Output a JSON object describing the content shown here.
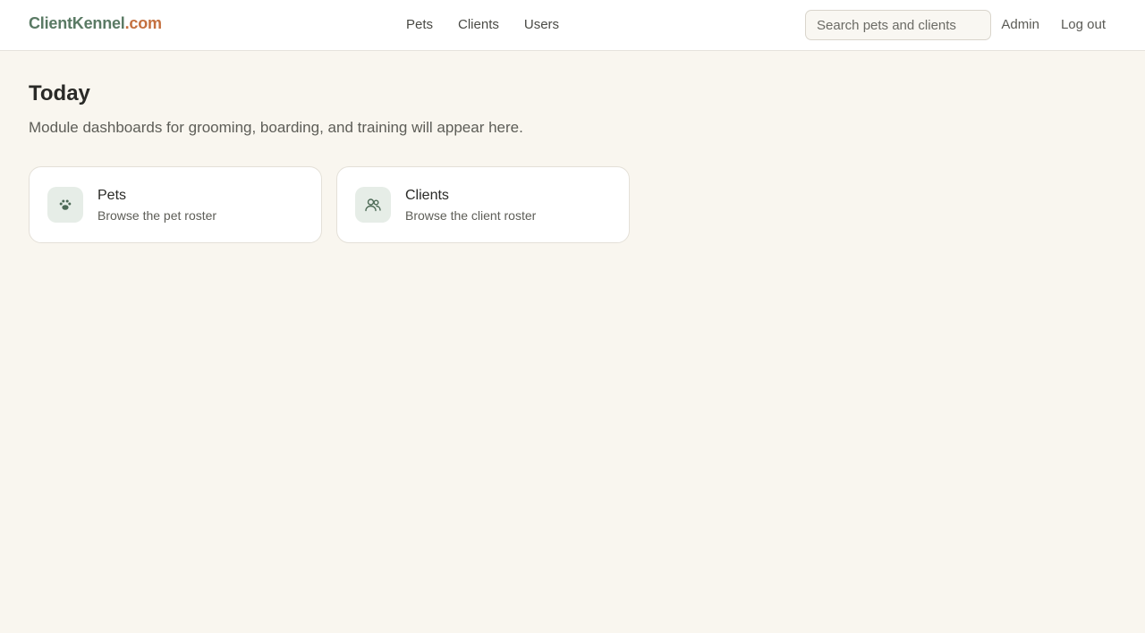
{
  "header": {
    "brand_main": "ClientKennel",
    "brand_tld": ".com",
    "nav": [
      {
        "label": "Pets"
      },
      {
        "label": "Clients"
      },
      {
        "label": "Users"
      }
    ],
    "search_placeholder": "Search pets and clients",
    "admin_label": "Admin",
    "logout_label": "Log out"
  },
  "main": {
    "title": "Today",
    "subtitle": "Module dashboards for grooming, boarding, and training will appear here.",
    "cards": [
      {
        "title": "Pets",
        "description": "Browse the pet roster",
        "icon": "paw-icon"
      },
      {
        "title": "Clients",
        "description": "Browse the client roster",
        "icon": "users-icon"
      }
    ]
  },
  "colors": {
    "background": "#f9f6ef",
    "brand_green": "#5a7a64",
    "brand_orange": "#c4703f",
    "icon_tile": "#e6ede7"
  }
}
